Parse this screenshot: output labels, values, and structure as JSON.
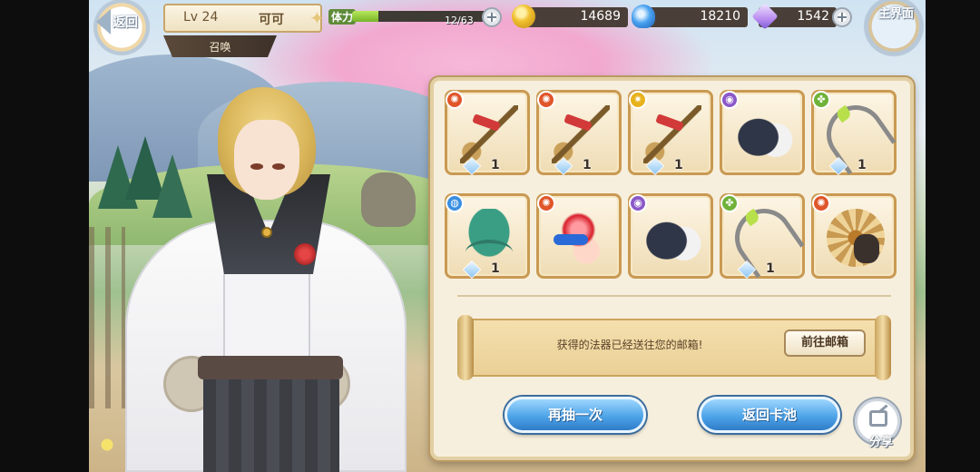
{
  "top_bar": {
    "back_label": "返回",
    "level_text": "Lv 24",
    "player_name": "可可",
    "section_label": "召唤",
    "stamina_label": "体力",
    "stamina_value": "12/63",
    "stamina_fraction": 0.19,
    "gold": "14689",
    "soul_flame": "18210",
    "gems": "1542",
    "home_label": "主界面"
  },
  "icons": {
    "back": "back-arrow-icon",
    "home": "home-icon",
    "gold": "gold-coin-icon",
    "soul": "soul-flame-icon",
    "gem": "crystal-gem-icon",
    "plus": "plus-icon",
    "share": "share-icon"
  },
  "items": [
    {
      "element": "fire",
      "art": "spear",
      "count": "1"
    },
    {
      "element": "fire",
      "art": "spear",
      "count": "1"
    },
    {
      "element": "light",
      "art": "spear",
      "count": "1"
    },
    {
      "element": "void",
      "art": "cloak",
      "count": ""
    },
    {
      "element": "wind",
      "art": "bow",
      "count": "1"
    },
    {
      "element": "water",
      "art": "claw",
      "count": "1"
    },
    {
      "element": "fire",
      "art": "orb",
      "count": ""
    },
    {
      "element": "void",
      "art": "cloak",
      "count": ""
    },
    {
      "element": "wind",
      "art": "bow",
      "count": "1"
    },
    {
      "element": "fire",
      "art": "wheel",
      "count": ""
    }
  ],
  "result": {
    "message": "获得的法器已经送往您的邮箱!",
    "mailbox_button": "前往邮箱",
    "draw_again_button": "再抽一次",
    "back_to_pool_button": "返回卡池",
    "share_label": "分享"
  },
  "colors": {
    "panel_bg": "#f7efdd",
    "card_border": "#c99a52",
    "button_blue": "#4ea4e8"
  }
}
